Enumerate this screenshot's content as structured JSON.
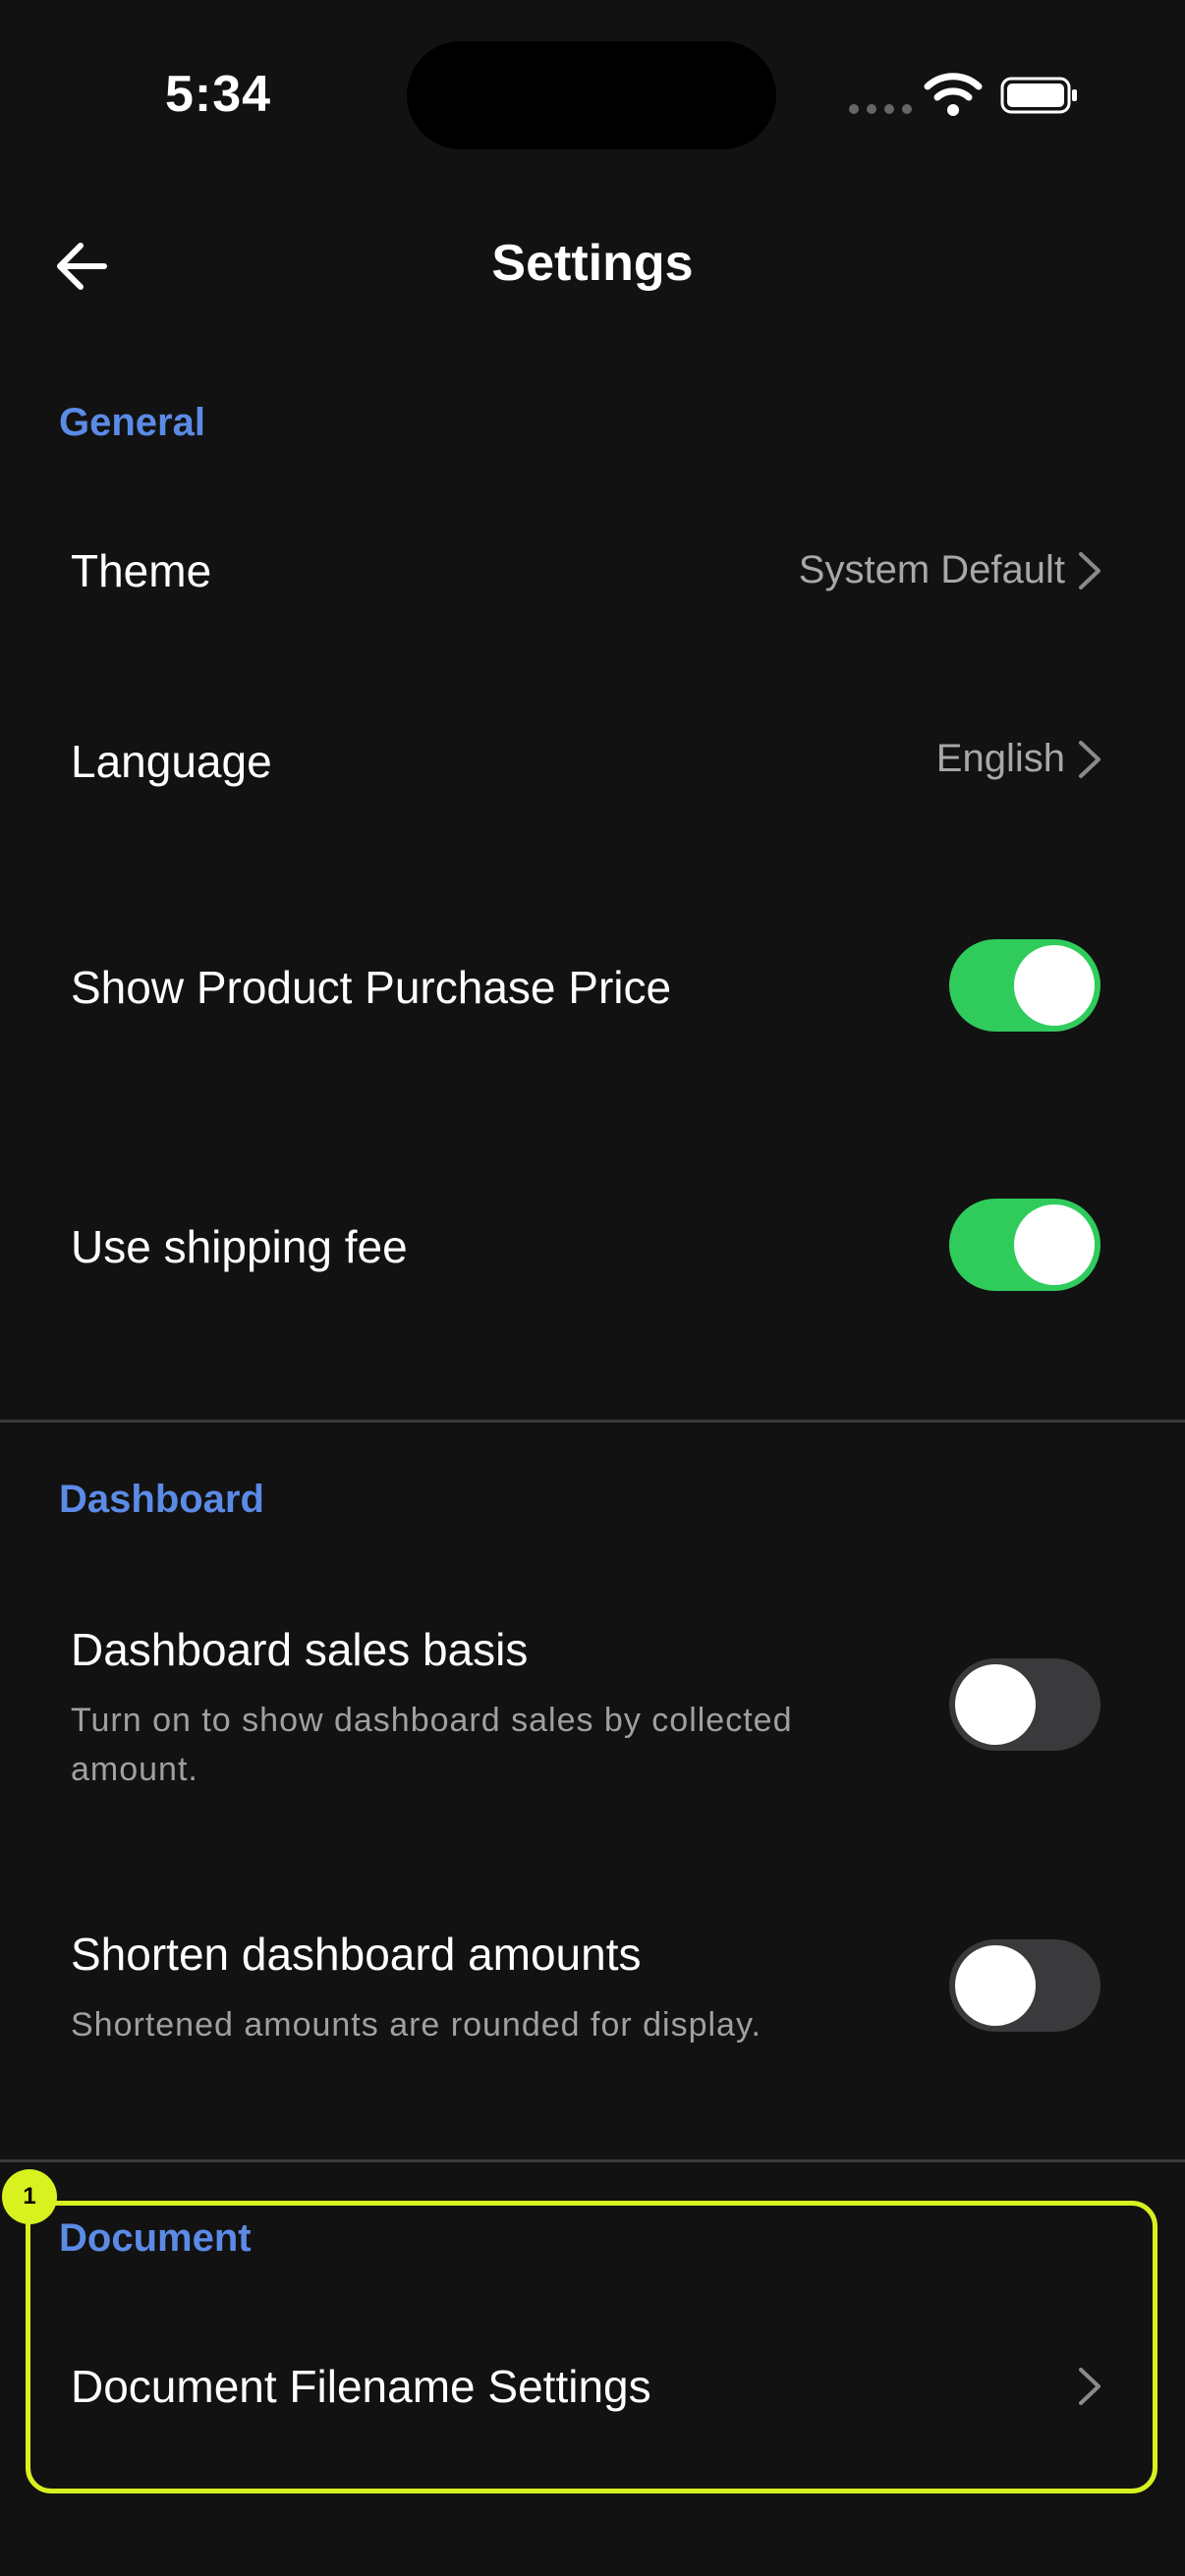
{
  "status_bar": {
    "time": "5:34"
  },
  "header": {
    "title": "Settings"
  },
  "general": {
    "label": "General",
    "theme": {
      "label": "Theme",
      "value": "System Default"
    },
    "language": {
      "label": "Language",
      "value": "English"
    },
    "show_purchase_price": {
      "label": "Show Product Purchase Price",
      "enabled": true
    },
    "shipping_fee": {
      "label": "Use shipping fee",
      "enabled": true
    }
  },
  "dashboard": {
    "label": "Dashboard",
    "sales_basis": {
      "label": "Dashboard sales basis",
      "description": "Turn on to show dashboard sales by collected amount.",
      "enabled": false
    },
    "shorten_amounts": {
      "label": "Shorten dashboard amounts",
      "description": "Shortened amounts are rounded for display.",
      "enabled": false
    }
  },
  "document": {
    "label": "Document",
    "filename_settings": {
      "label": "Document Filename Settings"
    }
  },
  "annotation": {
    "badge": "1",
    "color": "#d7f21f"
  },
  "colors": {
    "accent": "#5b8be6",
    "toggle_on": "#2fcc5c",
    "background": "#121212"
  }
}
